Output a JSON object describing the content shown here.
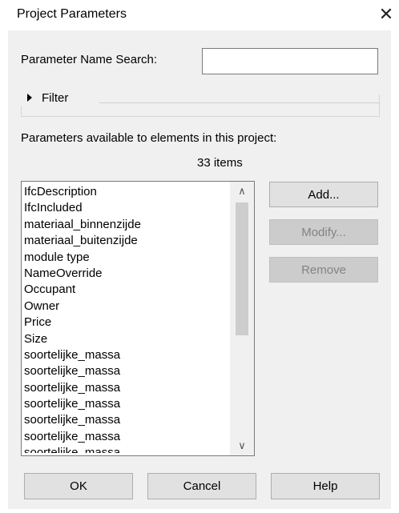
{
  "dialog": {
    "title": "Project Parameters",
    "close_glyph": "✕"
  },
  "search": {
    "label": "Parameter Name Search:",
    "value": "",
    "placeholder": ""
  },
  "filter": {
    "label": "Filter",
    "expanded": false
  },
  "parameters": {
    "caption": "Parameters available to elements in this project:",
    "count_label": "33 items",
    "items": [
      "IfcDescription",
      "IfcIncluded",
      "materiaal_binnenzijde",
      "materiaal_buitenzijde",
      "module type",
      "NameOverride",
      "Occupant",
      "Owner",
      "Price",
      "Size",
      "soortelijke_massa",
      "soortelijke_massa",
      "soortelijke_massa",
      "soortelijke_massa",
      "soortelijke_massa",
      "soortelijke_massa",
      "soortelijke_massa"
    ]
  },
  "side_buttons": {
    "add": "Add...",
    "modify": "Modify...",
    "remove": "Remove"
  },
  "footer_buttons": {
    "ok": "OK",
    "cancel": "Cancel",
    "help": "Help"
  },
  "colors": {
    "dialog_bg": "#f0f0f0",
    "button_bg": "#e1e1e1",
    "disabled_text": "#838383"
  }
}
